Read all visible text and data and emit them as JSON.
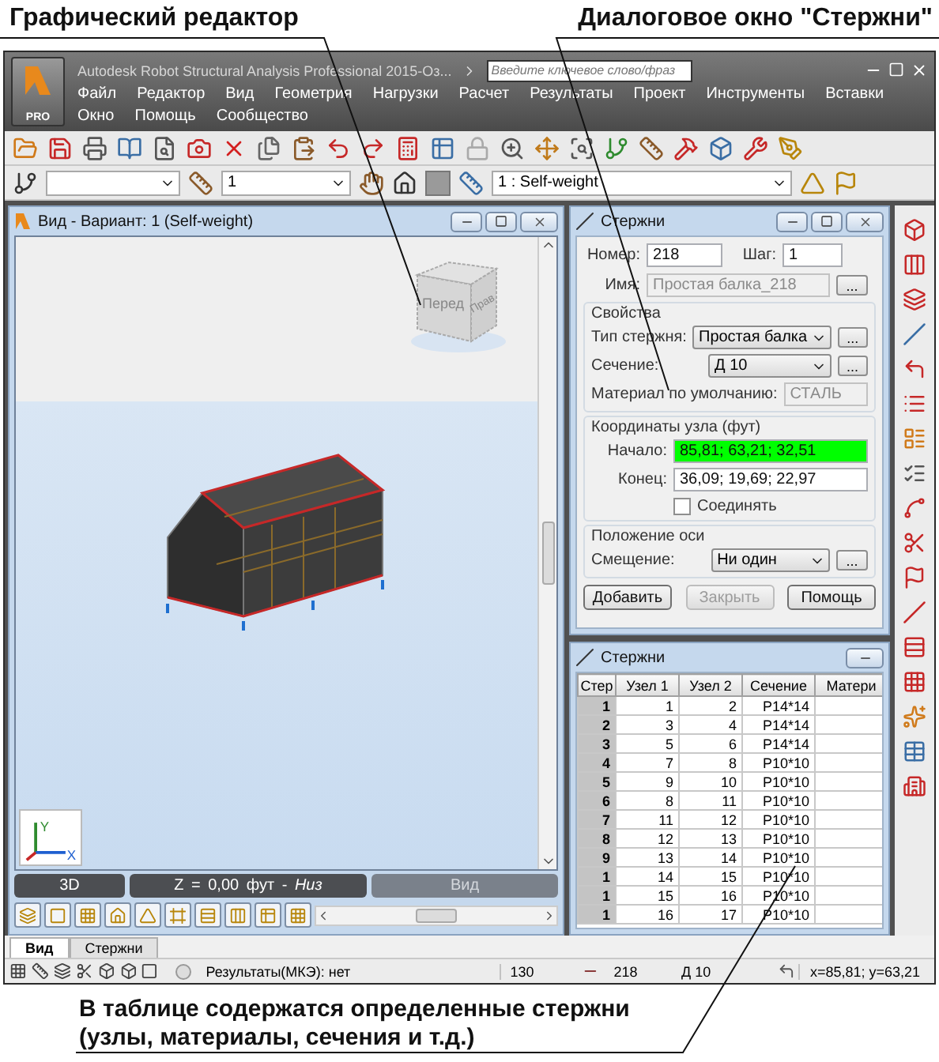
{
  "captions": {
    "editor": "Графический редактор",
    "dialog": "Диалоговое окно \"Стержни\"",
    "table": "В таблице содержатся определенные стержни (узлы, материалы, сечения и т.д.)"
  },
  "app": {
    "logo_badge": "PRO",
    "title": "Autodesk Robot Structural Analysis Professional 2015-Оз...",
    "search_placeholder": "Введите ключевое слово/фраз"
  },
  "menu_rows": [
    [
      "Файл",
      "Редактор",
      "Вид",
      "Геометрия",
      "Нагрузки",
      "Расчет",
      "Результаты",
      "Проект",
      "Инструменты",
      "Вставки"
    ],
    [
      "Окно",
      "Помощь",
      "Сообщество"
    ]
  ],
  "toolbar": {
    "case_number": "1",
    "load_case": "1 : Self-weight"
  },
  "view": {
    "title": "Вид - Вариант: 1 (Self-weight)",
    "cube_faces": [
      "Перед",
      "Прав"
    ],
    "axis_labels": [
      "Y",
      "X"
    ],
    "tabs": [
      {
        "label": "3D",
        "disabled": false
      },
      {
        "label": "Z = 0,00 фут - *Низ*",
        "disabled": false
      },
      {
        "label": "Вид",
        "disabled": true
      }
    ]
  },
  "dialog": {
    "title": "Стержни",
    "number": {
      "label": "Номер:",
      "value": "218"
    },
    "step": {
      "label": "Шаг:",
      "value": "1"
    },
    "name": {
      "label": "Имя:",
      "value": "Простая балка_218",
      "disabled": true,
      "more": "..."
    },
    "properties": {
      "title": "Свойства",
      "bar_type": {
        "label": "Тип стержня:",
        "value": "Простая балка",
        "more": "..."
      },
      "section": {
        "label": "Сечение:",
        "value": "Д 10",
        "more": "..."
      },
      "material": {
        "label": "Материал по умолчанию:",
        "value": "СТАЛЬ",
        "disabled": true
      }
    },
    "coordinates": {
      "title": "Координаты узла (фут)",
      "points": [
        {
          "label": "Начало:",
          "value": "85,81; 63,21; 32,51",
          "highlighted": true
        },
        {
          "label": "Конец:",
          "value": "36,09; 19,69; 22,97",
          "highlighted": false
        }
      ],
      "connect": {
        "label": "Соединять",
        "checked": false
      }
    },
    "axis": {
      "title": "Положение оси",
      "offset": {
        "label": "Смещение:",
        "value": "Ни один",
        "more": "..."
      }
    },
    "buttons": [
      {
        "label": "Добавить",
        "disabled": false
      },
      {
        "label": "Закрыть",
        "disabled": true
      },
      {
        "label": "Помощь",
        "disabled": false
      }
    ]
  },
  "table": {
    "title": "Стержни",
    "columns": [
      "Стер",
      "Узел 1",
      "Узел 2",
      "Сечение",
      "Матери"
    ],
    "rows": [
      [
        "1",
        "1",
        "2",
        "P14*14"
      ],
      [
        "2",
        "3",
        "4",
        "P14*14"
      ],
      [
        "3",
        "5",
        "6",
        "P14*14"
      ],
      [
        "4",
        "7",
        "8",
        "P10*10"
      ],
      [
        "5",
        "9",
        "10",
        "P10*10"
      ],
      [
        "6",
        "8",
        "11",
        "P10*10"
      ],
      [
        "7",
        "11",
        "12",
        "P10*10"
      ],
      [
        "8",
        "12",
        "13",
        "P10*10"
      ],
      [
        "9",
        "13",
        "14",
        "P10*10"
      ],
      [
        "1",
        "14",
        "15",
        "P10*10"
      ],
      [
        "1",
        "15",
        "16",
        "P10*10"
      ],
      [
        "1",
        "16",
        "17",
        "P10*10"
      ]
    ]
  },
  "bottom_tabs": [
    {
      "label": "Вид",
      "selected": true
    },
    {
      "label": "Стержни",
      "selected": false
    }
  ],
  "status": {
    "results_checked": false,
    "results": "Результаты(МКЭ): нет",
    "count": "130",
    "bar": "218",
    "section": "Д 10",
    "coords": "x=85,81; y=63,21"
  }
}
